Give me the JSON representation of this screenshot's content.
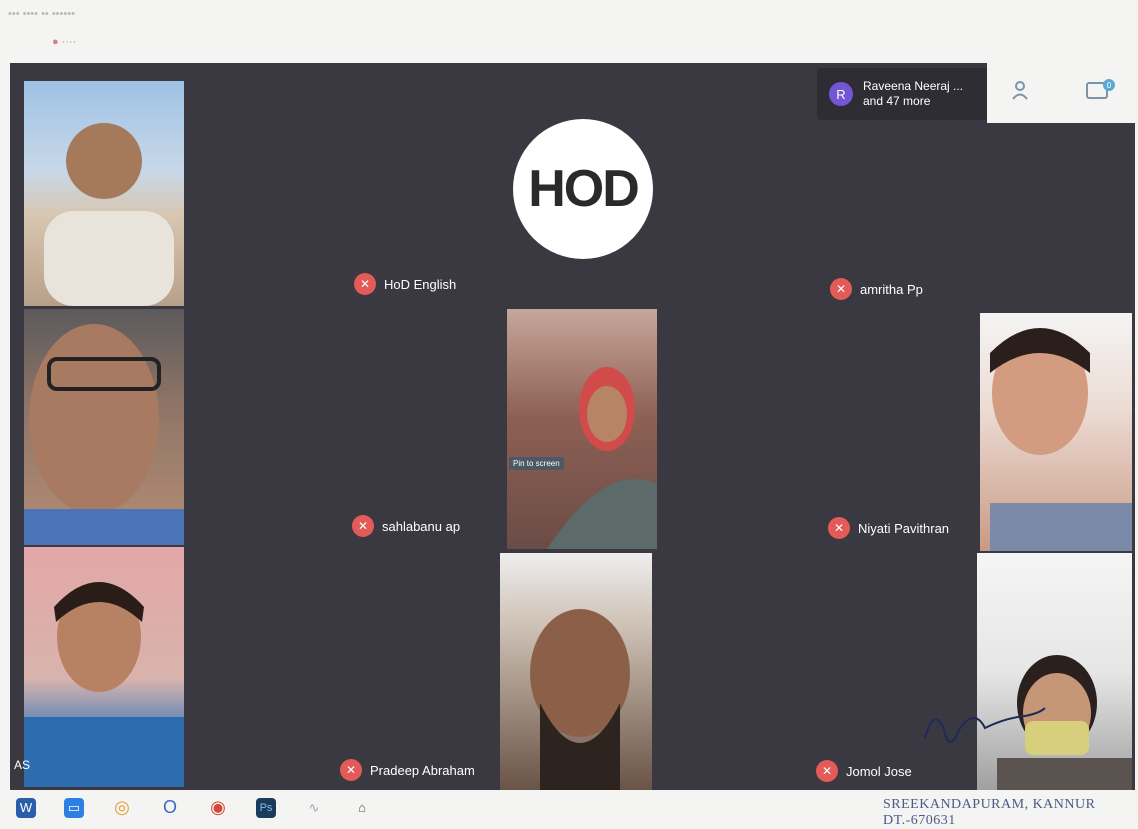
{
  "tabs_faint": "••• ••••   •• ••••••",
  "meet": {
    "banner": {
      "avatar": "R",
      "line1": "Raveena Neeraj ...",
      "line2": "and 47 more"
    },
    "hod_logo_text": "HOD",
    "pin_tooltip": "Pin to screen",
    "corner_text": "AS",
    "chat_badge": "0",
    "participants": [
      {
        "name": "HoD English"
      },
      {
        "name": "amritha Pp"
      },
      {
        "name": "sahlabanu ap"
      },
      {
        "name": "Niyati Pavithran"
      },
      {
        "name": "Pradeep Abraham"
      },
      {
        "name": "Jomol Jose"
      }
    ],
    "icons": {
      "mic_off": "mic-off-icon",
      "people": "people-icon",
      "chat": "chat-icon"
    }
  },
  "taskbar": {
    "icons": [
      "word-icon",
      "zoom-icon",
      "chrome-icon",
      "opera-icon",
      "chrome-icon",
      "photoshop-icon",
      "app-icon",
      "app-icon"
    ],
    "ps_label": "Ps"
  },
  "stamp_text": "SREEKANDAPURAM, KANNUR DT.-670631",
  "colors": {
    "meet_bg": "#3a3840",
    "mic_off": "#e35b59",
    "avatar": "#7456d4"
  }
}
